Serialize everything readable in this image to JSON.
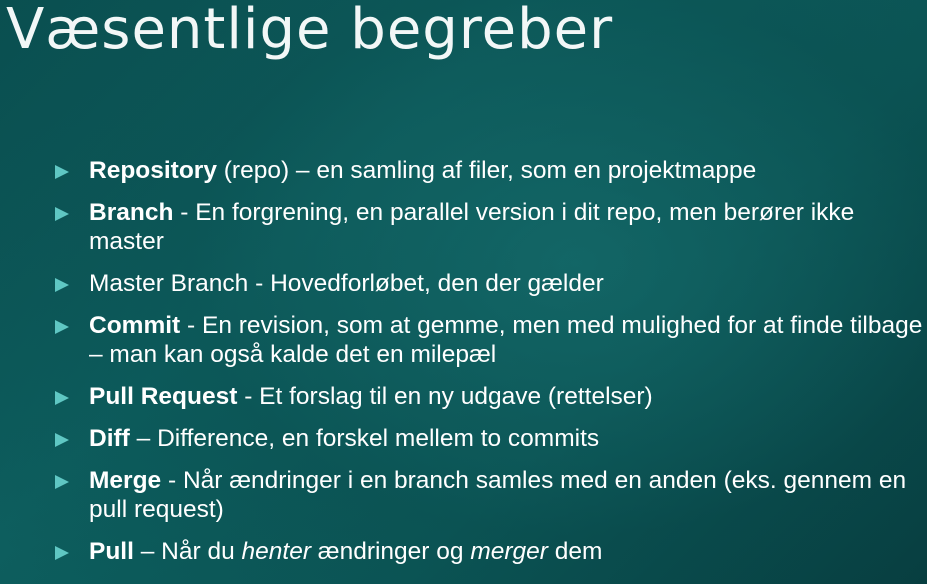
{
  "slide": {
    "title": "Væsentlige begreber"
  },
  "colors": {
    "background": "#0b5656",
    "bullet": "#5fc7c3",
    "text": "#ffffff"
  },
  "bullets": [
    {
      "term": "Repository",
      "text": " (repo) – en samling af filer, som en projektmappe"
    },
    {
      "term": "Branch",
      "text": " - En forgrening, en parallel version i dit repo, men berører ikke master"
    },
    {
      "text": "Master Branch - Hovedforløbet, den der gælder"
    },
    {
      "term": "Commit",
      "text": "  - En revision, som at gemme, men med mulighed for at finde tilbage – man kan også kalde det en milepæl"
    },
    {
      "term": "Pull Request",
      "text": " - Et forslag til en ny udgave (rettelser)"
    },
    {
      "term": "Diff",
      "text": " – Difference, en forskel mellem to commits"
    },
    {
      "term": "Merge",
      "text": " - Når ændringer i en branch samles med en anden (eks. gennem en pull request)"
    },
    {
      "term": "Pull",
      "text_1": " – Når du ",
      "em_1": "henter",
      "text_2": " ændringer og ",
      "em_2": "merger",
      "text_3": " dem"
    }
  ]
}
